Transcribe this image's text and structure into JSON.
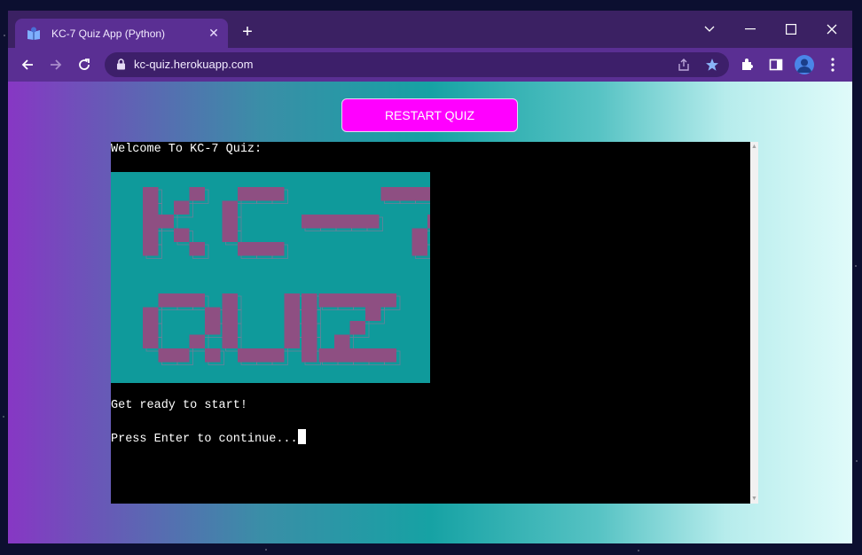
{
  "browser": {
    "tab_title": "KC-7 Quiz App (Python)",
    "url": "kc-quiz.herokuapp.com"
  },
  "page": {
    "restart_label": "RESTART QUIZ"
  },
  "terminal": {
    "lines": [
      "Welcome To KC-7 Quiz:",
      "Get ready to start!",
      "Press Enter to continue..."
    ],
    "banner_text": [
      "KC-7",
      "QUIZ"
    ]
  },
  "colors": {
    "accent_button": "#ff00ff",
    "banner_bg": "#0f9a9b",
    "banner_blocks": "#8e4f82",
    "browser_frame": "#3b2163"
  }
}
